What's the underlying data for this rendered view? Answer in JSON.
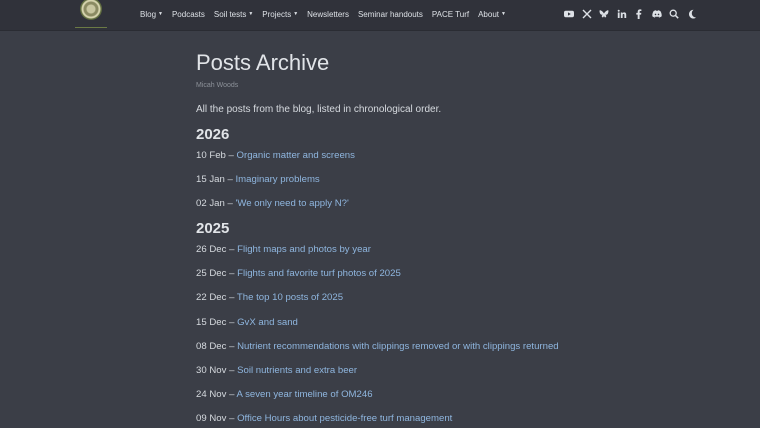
{
  "nav": {
    "items": [
      {
        "label": "Blog",
        "dropdown": true
      },
      {
        "label": "Podcasts",
        "dropdown": false
      },
      {
        "label": "Soil tests",
        "dropdown": true
      },
      {
        "label": "Projects",
        "dropdown": true
      },
      {
        "label": "Newsletters",
        "dropdown": false
      },
      {
        "label": "Seminar handouts",
        "dropdown": false
      },
      {
        "label": "PACE Turf",
        "dropdown": false
      },
      {
        "label": "About",
        "dropdown": true
      }
    ],
    "icons": [
      "youtube-icon",
      "x-icon",
      "bluesky-icon",
      "linkedin-icon",
      "facebook-icon",
      "discord-icon",
      "search-icon",
      "dark-mode-icon"
    ]
  },
  "page": {
    "title": "Posts Archive",
    "author": "Micah Woods",
    "intro": "All the posts from the blog, listed in chronological order."
  },
  "years": [
    {
      "year": "2026",
      "posts": [
        {
          "date": "10 Feb",
          "title": "Organic matter and screens"
        },
        {
          "date": "15 Jan",
          "title": "Imaginary problems"
        },
        {
          "date": "02 Jan",
          "title": "'We only need to apply N?'"
        }
      ]
    },
    {
      "year": "2025",
      "posts": [
        {
          "date": "26 Dec",
          "title": "Flight maps and photos by year"
        },
        {
          "date": "25 Dec",
          "title": "Flights and favorite turf photos of 2025"
        },
        {
          "date": "22 Dec",
          "title": "The top 10 posts of 2025"
        },
        {
          "date": "15 Dec",
          "title": "GvX and sand"
        },
        {
          "date": "08 Dec",
          "title": "Nutrient recommendations with clippings removed or with clippings returned"
        },
        {
          "date": "30 Nov",
          "title": "Soil nutrients and extra beer"
        },
        {
          "date": "24 Nov",
          "title": "A seven year timeline of OM246"
        },
        {
          "date": "09 Nov",
          "title": "Office Hours about pesticide-free turf management"
        }
      ]
    }
  ],
  "separator": " – ",
  "colors": {
    "background": "#3b3e47",
    "navbar": "#30323a",
    "link": "#8fb6df"
  }
}
